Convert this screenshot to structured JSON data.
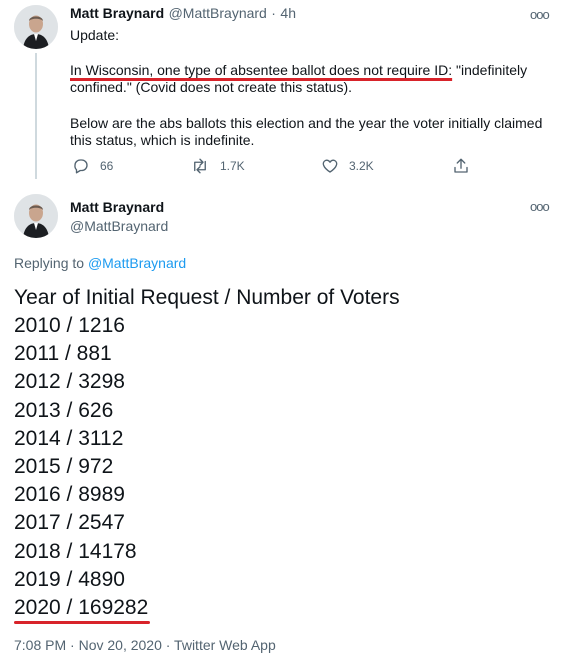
{
  "parent_tweet": {
    "author_name": "Matt Braynard",
    "handle": "@MattBraynard",
    "separator": "·",
    "time": "4h",
    "more_icon": "ooo",
    "lines": {
      "update": "Update:",
      "p1_part1": "In Wisconsin, one type of absentee ballot does not require  ID:",
      "p1_part2": " \"indefinitely confined.\" (Covid does not create this status).",
      "p2": "Below are the abs ballots this election and the year the voter initially claimed this status, which is indefinite."
    },
    "actions": {
      "reply_count": "66",
      "retweet_count": "1.7K",
      "like_count": "3.2K"
    }
  },
  "main_tweet": {
    "author_name": "Matt Braynard",
    "handle": "@MattBraynard",
    "more_icon": "ooo",
    "replying_prefix": "Replying to ",
    "replying_handle": "@MattBraynard",
    "header_line": "Year of Initial Request / Number of Voters",
    "rows": [
      "2010 / 1216",
      "2011 / 881",
      "2012 / 3298",
      "2013 / 626",
      "2014 / 3112",
      "2015 / 972",
      "2016 / 8989",
      "2017 / 2547",
      "2018 / 14178",
      "2019 / 4890",
      "2020 / 169282"
    ],
    "footer": "7:08 PM · Nov 20, 2020 · Twitter Web App"
  },
  "colors": {
    "link": "#1d9bf0",
    "annotation_red": "#d8232a",
    "muted": "#536471"
  }
}
